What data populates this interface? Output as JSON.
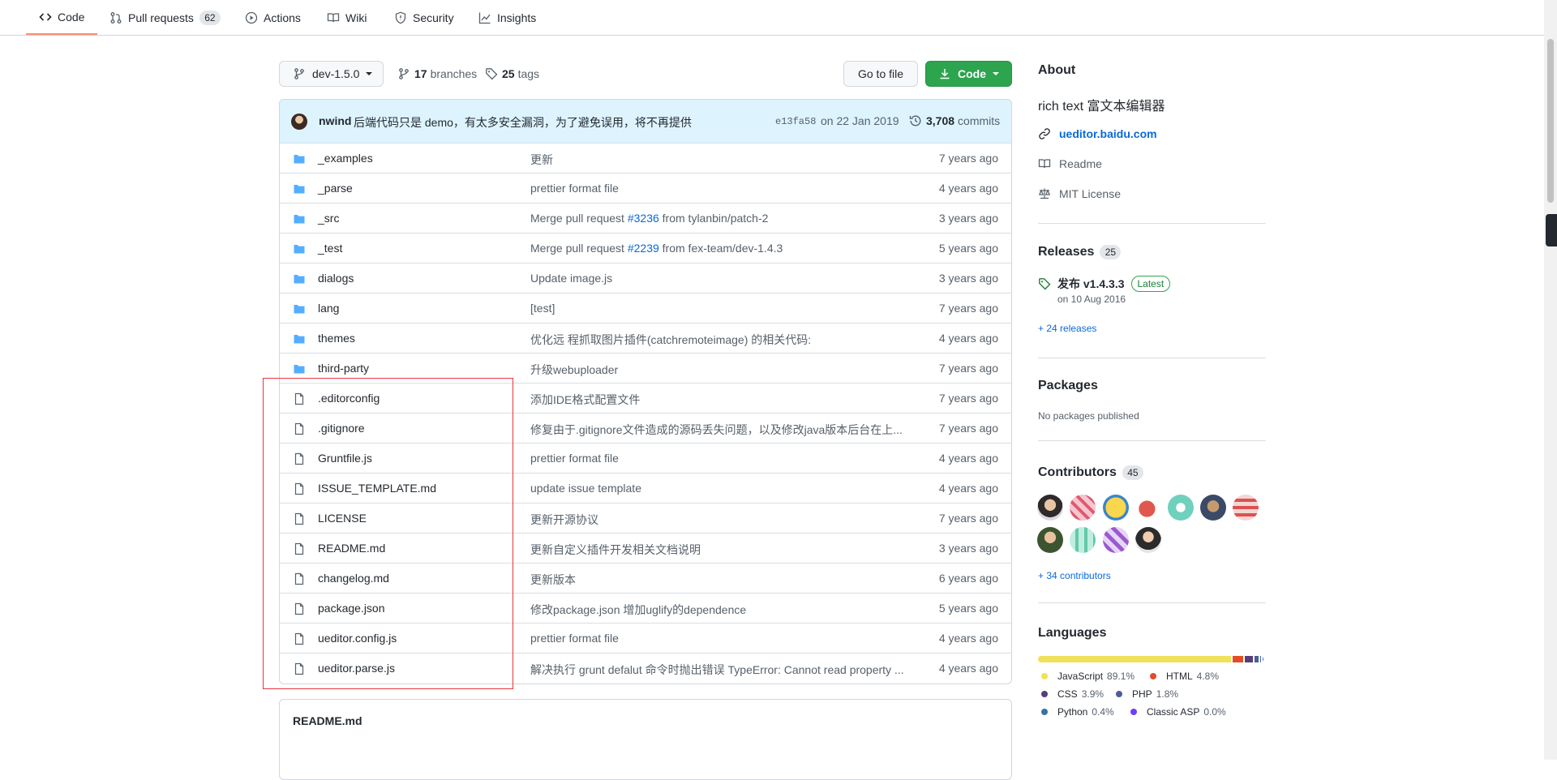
{
  "nav": {
    "tabs": [
      {
        "label": "Code",
        "icon": "code-icon"
      },
      {
        "label": "Pull requests",
        "icon": "git-pull-request-icon",
        "count": "62"
      },
      {
        "label": "Actions",
        "icon": "play-icon"
      },
      {
        "label": "Wiki",
        "icon": "book-icon"
      },
      {
        "label": "Security",
        "icon": "shield-icon"
      },
      {
        "label": "Insights",
        "icon": "graph-icon"
      }
    ]
  },
  "toolbar": {
    "branch": "dev-1.5.0",
    "branches_count": "17",
    "branches_label": "branches",
    "tags_count": "25",
    "tags_label": "tags",
    "go_to_file": "Go to file",
    "code_button": "Code"
  },
  "commit": {
    "author": "nwind",
    "message": "后端代码只是 demo，有太多安全漏洞，为了避免误用，将不再提供",
    "sha": "e13fa58",
    "date": "on 22 Jan 2019",
    "count": "3,708",
    "count_label": "commits"
  },
  "files": [
    {
      "type": "dir",
      "name": "_examples",
      "message": "更新",
      "age": "7 years ago"
    },
    {
      "type": "dir",
      "name": "_parse",
      "message": "prettier format file",
      "age": "4 years ago"
    },
    {
      "type": "dir",
      "name": "_src",
      "message_pre": "Merge pull request ",
      "message_link": "#3236",
      "message_post": " from tylanbin/patch-2",
      "age": "3 years ago"
    },
    {
      "type": "dir",
      "name": "_test",
      "message_pre": "Merge pull request ",
      "message_link": "#2239",
      "message_post": " from fex-team/dev-1.4.3",
      "age": "5 years ago"
    },
    {
      "type": "dir",
      "name": "dialogs",
      "message": "Update image.js",
      "age": "3 years ago"
    },
    {
      "type": "dir",
      "name": "lang",
      "message": "[test]",
      "age": "7 years ago"
    },
    {
      "type": "dir",
      "name": "themes",
      "message": "优化远 程抓取图片插件(catchremoteimage) 的相关代码:",
      "age": "4 years ago"
    },
    {
      "type": "dir",
      "name": "third-party",
      "message": "升级webuploader",
      "age": "7 years ago"
    },
    {
      "type": "file",
      "name": ".editorconfig",
      "message": "添加IDE格式配置文件",
      "age": "7 years ago"
    },
    {
      "type": "file",
      "name": ".gitignore",
      "message": "修复由于.gitignore文件造成的源码丢失问题，以及修改java版本后台在上...",
      "age": "7 years ago"
    },
    {
      "type": "file",
      "name": "Gruntfile.js",
      "message": "prettier format file",
      "age": "4 years ago"
    },
    {
      "type": "file",
      "name": "ISSUE_TEMPLATE.md",
      "message": "update issue template",
      "age": "4 years ago"
    },
    {
      "type": "file",
      "name": "LICENSE",
      "message": "更新开源协议",
      "age": "7 years ago"
    },
    {
      "type": "file",
      "name": "README.md",
      "message": "更新自定义插件开发相关文档说明",
      "age": "3 years ago"
    },
    {
      "type": "file",
      "name": "changelog.md",
      "message": "更新版本",
      "age": "6 years ago"
    },
    {
      "type": "file",
      "name": "package.json",
      "message": "修改package.json 增加uglify的dependence",
      "age": "5 years ago"
    },
    {
      "type": "file",
      "name": "ueditor.config.js",
      "message": "prettier format file",
      "age": "4 years ago"
    },
    {
      "type": "file",
      "name": "ueditor.parse.js",
      "message": "解决执行 grunt defalut 命令时抛出错误 TypeError: Cannot read property ...",
      "age": "4 years ago"
    }
  ],
  "readme": {
    "title": "README.md"
  },
  "about": {
    "heading": "About",
    "description": "rich text 富文本编辑器",
    "website": "ueditor.baidu.com",
    "readme": "Readme",
    "license": "MIT License"
  },
  "releases": {
    "heading": "Releases",
    "count": "25",
    "latest_name": "发布 v1.4.3.3",
    "latest_badge": "Latest",
    "latest_date": "on 10 Aug 2016",
    "more": "+ 24 releases"
  },
  "packages": {
    "heading": "Packages",
    "empty": "No packages published"
  },
  "contributors": {
    "heading": "Contributors",
    "count": "45",
    "more": "+ 34 contributors"
  },
  "languages": {
    "heading": "Languages",
    "items": [
      {
        "name": "JavaScript",
        "pct": "89.1%",
        "color": "#f1e05a",
        "value": 89.1
      },
      {
        "name": "HTML",
        "pct": "4.8%",
        "color": "#e34c26",
        "value": 4.8
      },
      {
        "name": "CSS",
        "pct": "3.9%",
        "color": "#563d7c",
        "value": 3.9
      },
      {
        "name": "PHP",
        "pct": "1.8%",
        "color": "#4F5D95",
        "value": 1.8
      },
      {
        "name": "Python",
        "pct": "0.4%",
        "color": "#3572A5",
        "value": 0.4
      },
      {
        "name": "Classic ASP",
        "pct": "0.0%",
        "color": "#6a40fd",
        "value": 0.0
      }
    ]
  }
}
